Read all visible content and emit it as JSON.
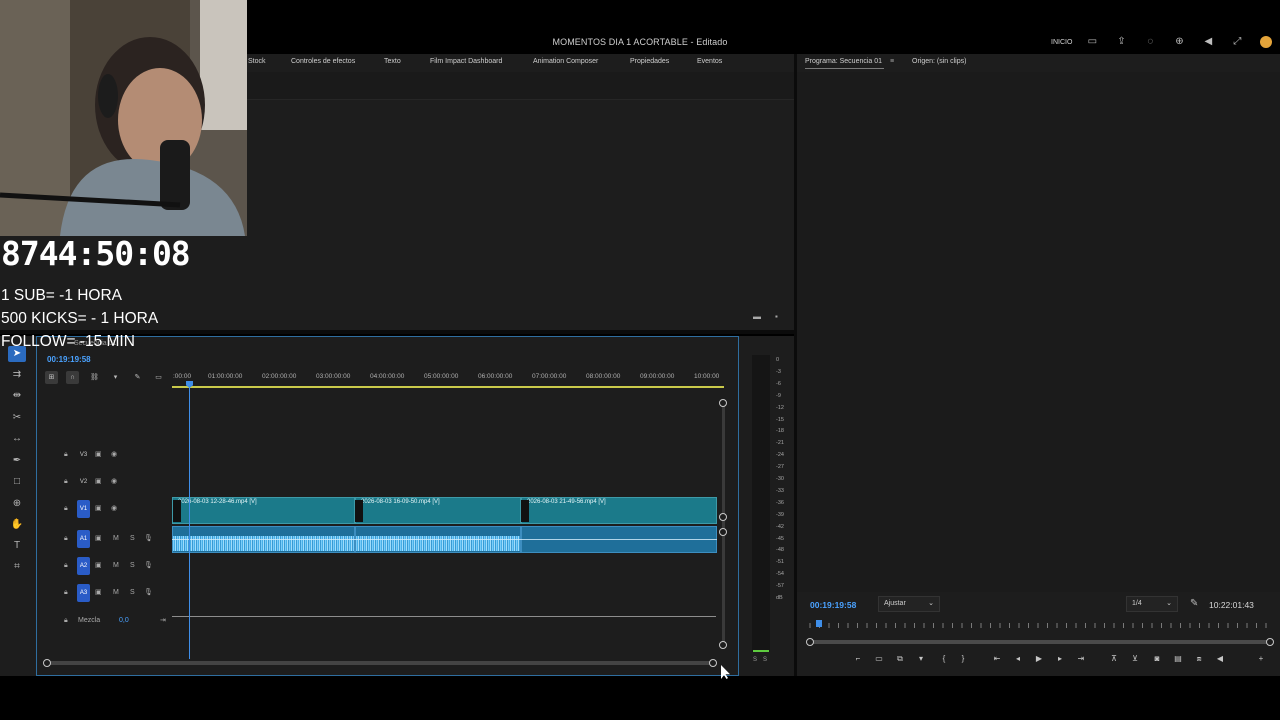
{
  "window": {
    "title": "MOMENTOS DIA 1 ACORTABLE - Editado",
    "inicio_label": "INICIO"
  },
  "effects_panel": {
    "tabs": [
      "Stock",
      "Controles de efectos",
      "Texto",
      "Film Impact Dashboard",
      "Animation Composer",
      "Propiedades",
      "Eventos"
    ]
  },
  "program_panel": {
    "tabs": [
      "Programa: Secuencia 01",
      "Origen: (sin clips)"
    ],
    "menu_icon": "≡",
    "timecode": "00:19:19:58",
    "fit": "Ajustar",
    "resolution": "1/4",
    "duration": "10:22:01:43"
  },
  "timeline": {
    "sequence_name": "Secuencia 01",
    "timecode": "00:19:19:58",
    "ruler_ticks": [
      ":00:00",
      "01:00:00:00",
      "02:00:00:00",
      "03:00:00:00",
      "04:00:00:00",
      "05:00:00:00",
      "06:00:00:00",
      "07:00:00:00",
      "08:00:00:00",
      "09:00:00:00",
      "10:00:00"
    ],
    "tracks": {
      "video": [
        "V3",
        "V2",
        "V1"
      ],
      "audio": [
        "A1",
        "A2",
        "A3"
      ],
      "mix_label": "Mezcla",
      "mix_value": "0,0",
      "m_label": "M",
      "s_label": "S"
    },
    "clips": [
      {
        "label": "2026-08-03 12-28-46.mp4 [V]"
      },
      {
        "label": "2026-08-03 16-09-50.mp4 [V]"
      },
      {
        "label": "2026-08-03 21-49-56.mp4 [V]"
      }
    ]
  },
  "meters": {
    "labels": [
      "0",
      "-3",
      "-6",
      "-9",
      "-12",
      "-15",
      "-18",
      "-21",
      "-24",
      "-27",
      "-30",
      "-33",
      "-36",
      "-39",
      "-42",
      "-45",
      "-48",
      "-51",
      "-54",
      "-57",
      "dB"
    ],
    "solo_labels": [
      "S",
      "S"
    ]
  },
  "overlay": {
    "countdown": "8744:50:08",
    "rules": [
      "1 SUB= -1 HORA",
      "500 KICKS= - 1 HORA",
      "FOLLOW= -15 MIN"
    ]
  },
  "colors": {
    "accent": "#3f8ee8",
    "video_clip": "#1b7a8a",
    "audio_clip": "#1f6f9a",
    "track_active": "#2a5cc7"
  }
}
